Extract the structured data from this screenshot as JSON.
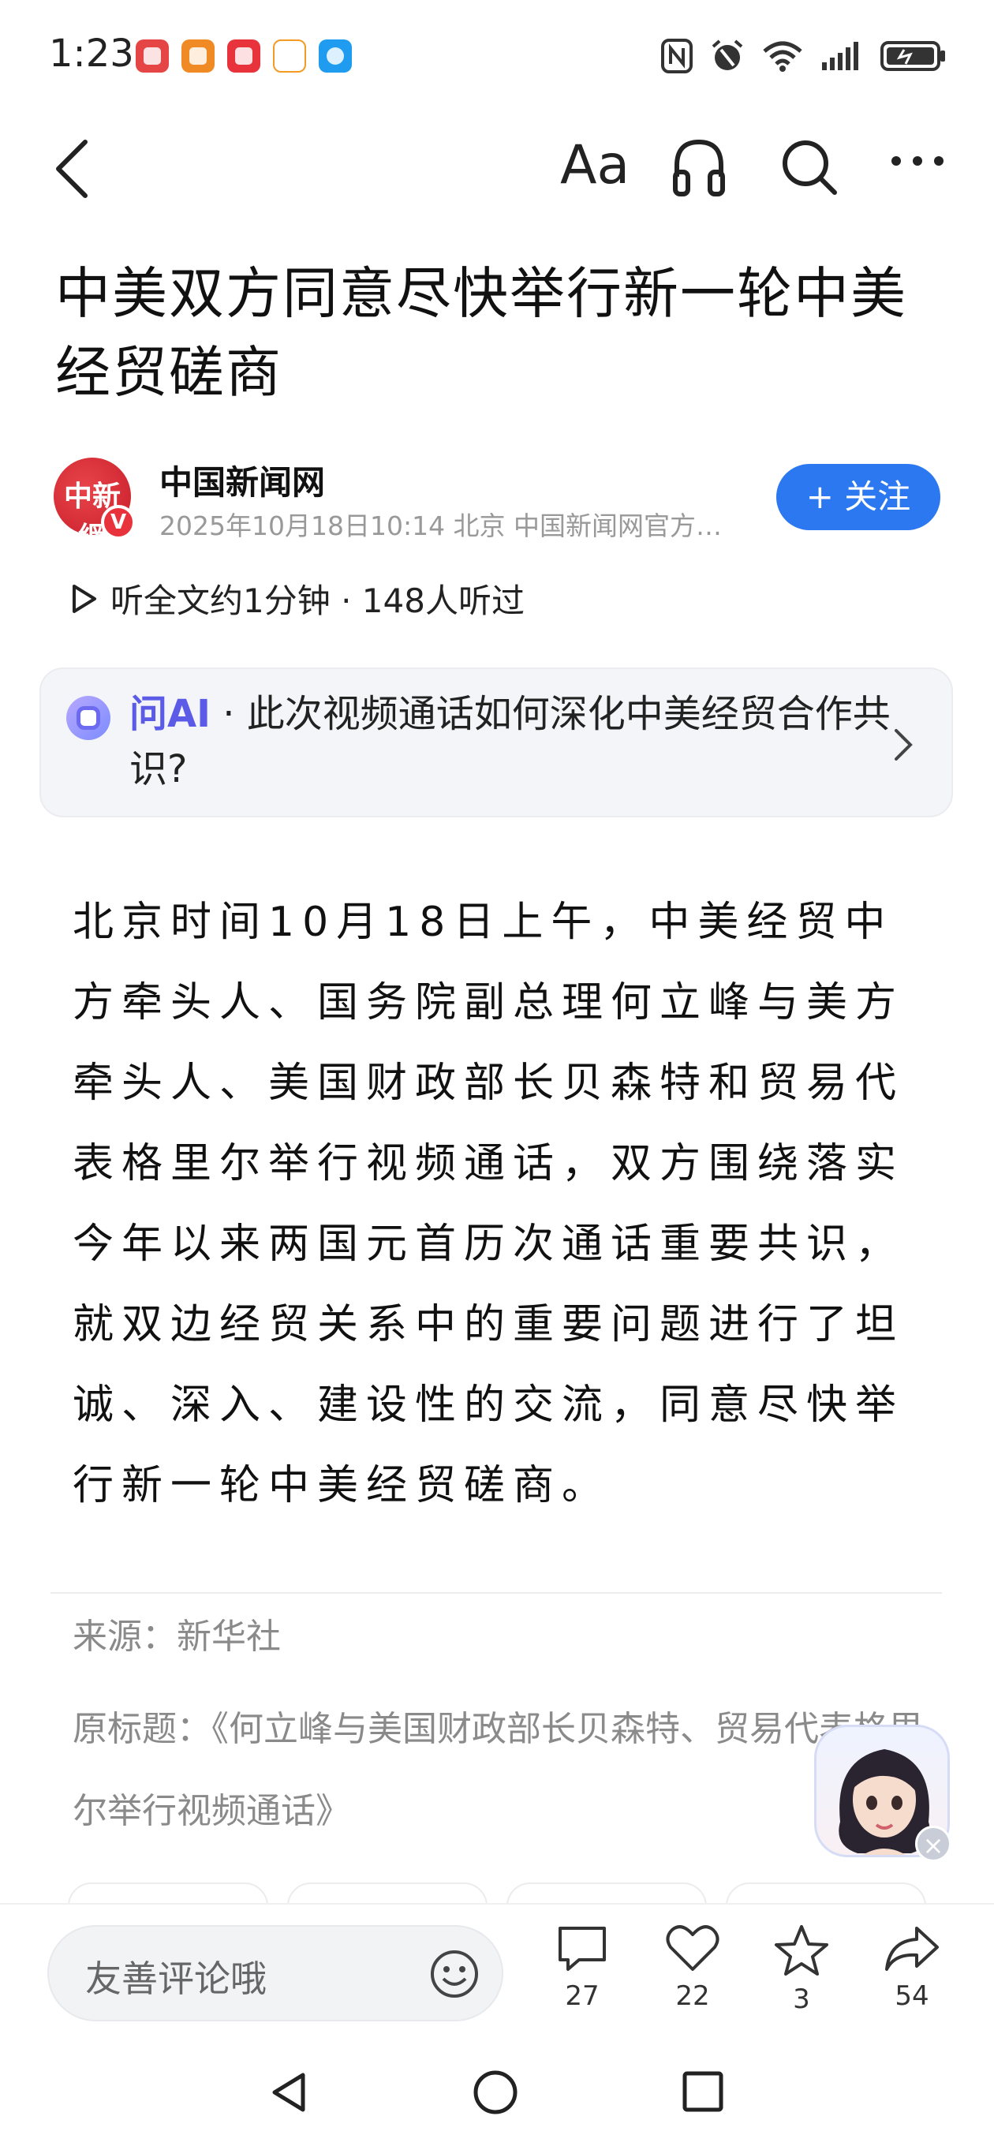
{
  "status_bar": {
    "time": "1:23",
    "notification_icons": [
      "huawei-app-icon",
      "gift-app-icon",
      "red-app-icon",
      "tv-app-icon",
      "chat-app-icon"
    ],
    "system_icons": [
      "nfc-icon",
      "alarm-icon",
      "wifi-icon",
      "signal-icon",
      "battery-icon"
    ]
  },
  "toolbar": {
    "back_icon": "chevron-left-icon",
    "font_label": "Aa",
    "headphone_icon": "headphone-icon",
    "search_icon": "search-icon",
    "more_icon": "more-icon"
  },
  "article": {
    "title": "中美双方同意尽快举行新一轮中美经贸磋商",
    "author": {
      "avatar_text": "中新網",
      "verified_badge": "V",
      "name": "中国新闻网",
      "meta": "2025年10月18日10:14 北京 中国新闻网官方…",
      "follow_label": "+ 关注"
    },
    "listen": {
      "text": "听全文约1分钟 · 148人听过"
    },
    "ask_ai": {
      "label": "问AI",
      "separator": " · ",
      "question": "此次视频通话如何深化中美经贸合作共识?"
    },
    "body": "北京时间10月18日上午，中美经贸中方牵头人、国务院副总理何立峰与美方牵头人、美国财政部长贝森特和贸易代表格里尔举行视频通话，双方围绕落实今年以来两国元首历次通话重要共识，就双边经贸关系中的重要问题进行了坦诚、深入、建设性的交流，同意尽快举行新一轮中美经贸磋商。",
    "source": "来源：新华社",
    "original_title": "原标题：《何立峰与美国财政部长贝森特、贸易代表格里尔举行视频通话》"
  },
  "bottom_bar": {
    "comment_placeholder": "友善评论哦",
    "comment_count": "27",
    "like_count": "22",
    "favorite_count": "3",
    "share_count": "54"
  },
  "colors": {
    "accent_blue": "#2b78f0",
    "ai_purple": "#5b5be8",
    "brand_red": "#e8323c"
  }
}
